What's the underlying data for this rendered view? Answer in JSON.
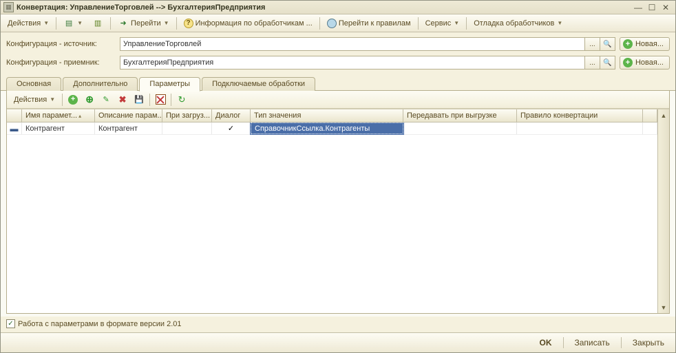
{
  "window": {
    "title": "Конвертация: УправлениеТорговлей --> БухгалтерияПредприятия"
  },
  "toolbar": {
    "actions": "Действия",
    "goto": "Перейти",
    "info": "Информация по обработчикам ...",
    "goto_rules": "Перейти к правилам",
    "service": "Сервис",
    "debug": "Отладка обработчиков"
  },
  "form": {
    "source_label": "Конфигурация - источник:",
    "source_value": "УправлениеТорговлей",
    "target_label": "Конфигурация - приемник:",
    "target_value": "БухгалтерияПредприятия",
    "ellipsis": "...",
    "new_btn": "Новая..."
  },
  "tabs": {
    "main": "Основная",
    "advanced": "Дополнительно",
    "params": "Параметры",
    "plugins": "Подключаемые обработки"
  },
  "subtoolbar": {
    "actions": "Действия"
  },
  "grid": {
    "headers": {
      "name": "Имя парамет...",
      "desc": "Описание парам...",
      "onload": "При загруз...",
      "dialog": "Диалог",
      "type": "Тип значения",
      "pass": "Передавать при выгрузке",
      "rule": "Правило конвертации"
    },
    "rows": [
      {
        "name": "Контрагент",
        "desc": "Контрагент",
        "onload": "",
        "dialog": "✓",
        "type": "СправочникСсылка.Контрагенты",
        "pass": "",
        "rule": ""
      }
    ]
  },
  "checkbox": {
    "label": "Работа с параметрами в формате версии 2.01",
    "checked": "✓"
  },
  "footer": {
    "ok": "OK",
    "save": "Записать",
    "close": "Закрыть"
  }
}
